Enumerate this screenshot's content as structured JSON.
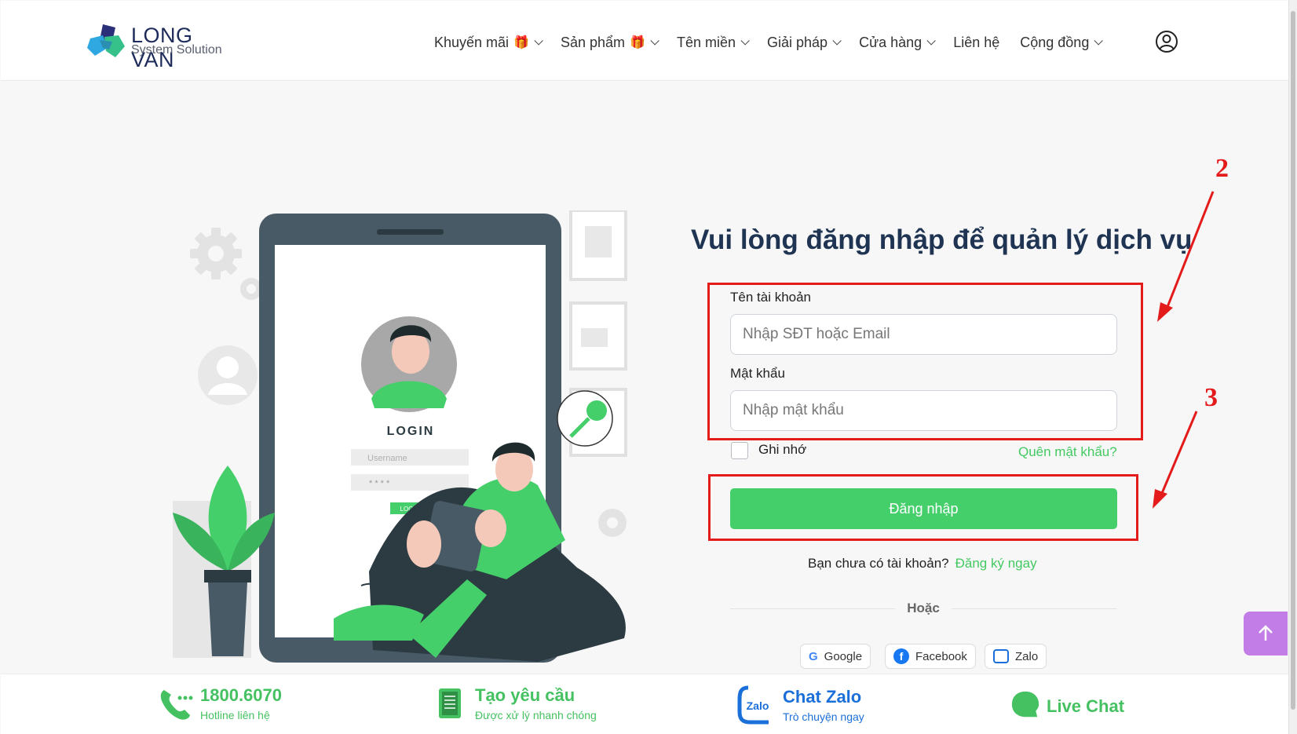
{
  "brand": {
    "line1": "LONG VAN",
    "line2": "System Solution"
  },
  "nav": {
    "items": [
      {
        "label": "Khuyến mãi",
        "gift": true,
        "dropdown": true
      },
      {
        "label": "Sản phẩm",
        "gift": true,
        "dropdown": true
      },
      {
        "label": "Tên miền",
        "gift": false,
        "dropdown": true
      },
      {
        "label": "Giải pháp",
        "gift": false,
        "dropdown": true
      },
      {
        "label": "Cửa hàng",
        "gift": false,
        "dropdown": true
      },
      {
        "label": "Liên hệ",
        "gift": false,
        "dropdown": false
      },
      {
        "label": "Cộng đồng",
        "gift": false,
        "dropdown": true
      }
    ]
  },
  "illustration": {
    "title": "LOGIN",
    "username_placeholder": "Username",
    "password_placeholder": "* * * *",
    "button": "LOGIN"
  },
  "login": {
    "title": "Vui lòng đăng nhập để quản lý dịch vụ",
    "username_label": "Tên tài khoản",
    "username_placeholder": "Nhập SĐT hoặc Email",
    "password_label": "Mật khẩu",
    "password_placeholder": "Nhập mật khẩu",
    "remember_label": "Ghi nhớ",
    "forgot_label": "Quên mật khẩu?",
    "submit_label": "Đăng nhập",
    "no_account_text": "Bạn chưa có tài khoản?",
    "signup_label": "Đăng ký ngay",
    "or_text": "Hoặc",
    "social": [
      "Google",
      "Facebook",
      "Zalo"
    ]
  },
  "annotations": {
    "step2": "2",
    "step3": "3"
  },
  "footer": {
    "hotline_title": "1800.6070",
    "hotline_sub": "Hotline liên hệ",
    "request_title": "Tạo yêu cầu",
    "request_sub": "Được xử lý nhanh chóng",
    "zalo_title": "Chat Zalo",
    "zalo_sub": "Trò chuyện ngay",
    "zalo_icon_text": "Zalo",
    "livechat_title": "Live Chat"
  },
  "colors": {
    "accent": "#45cf6b",
    "annotation": "#e31b1b",
    "title": "#1f3452",
    "scroll_top": "#c27de6"
  }
}
